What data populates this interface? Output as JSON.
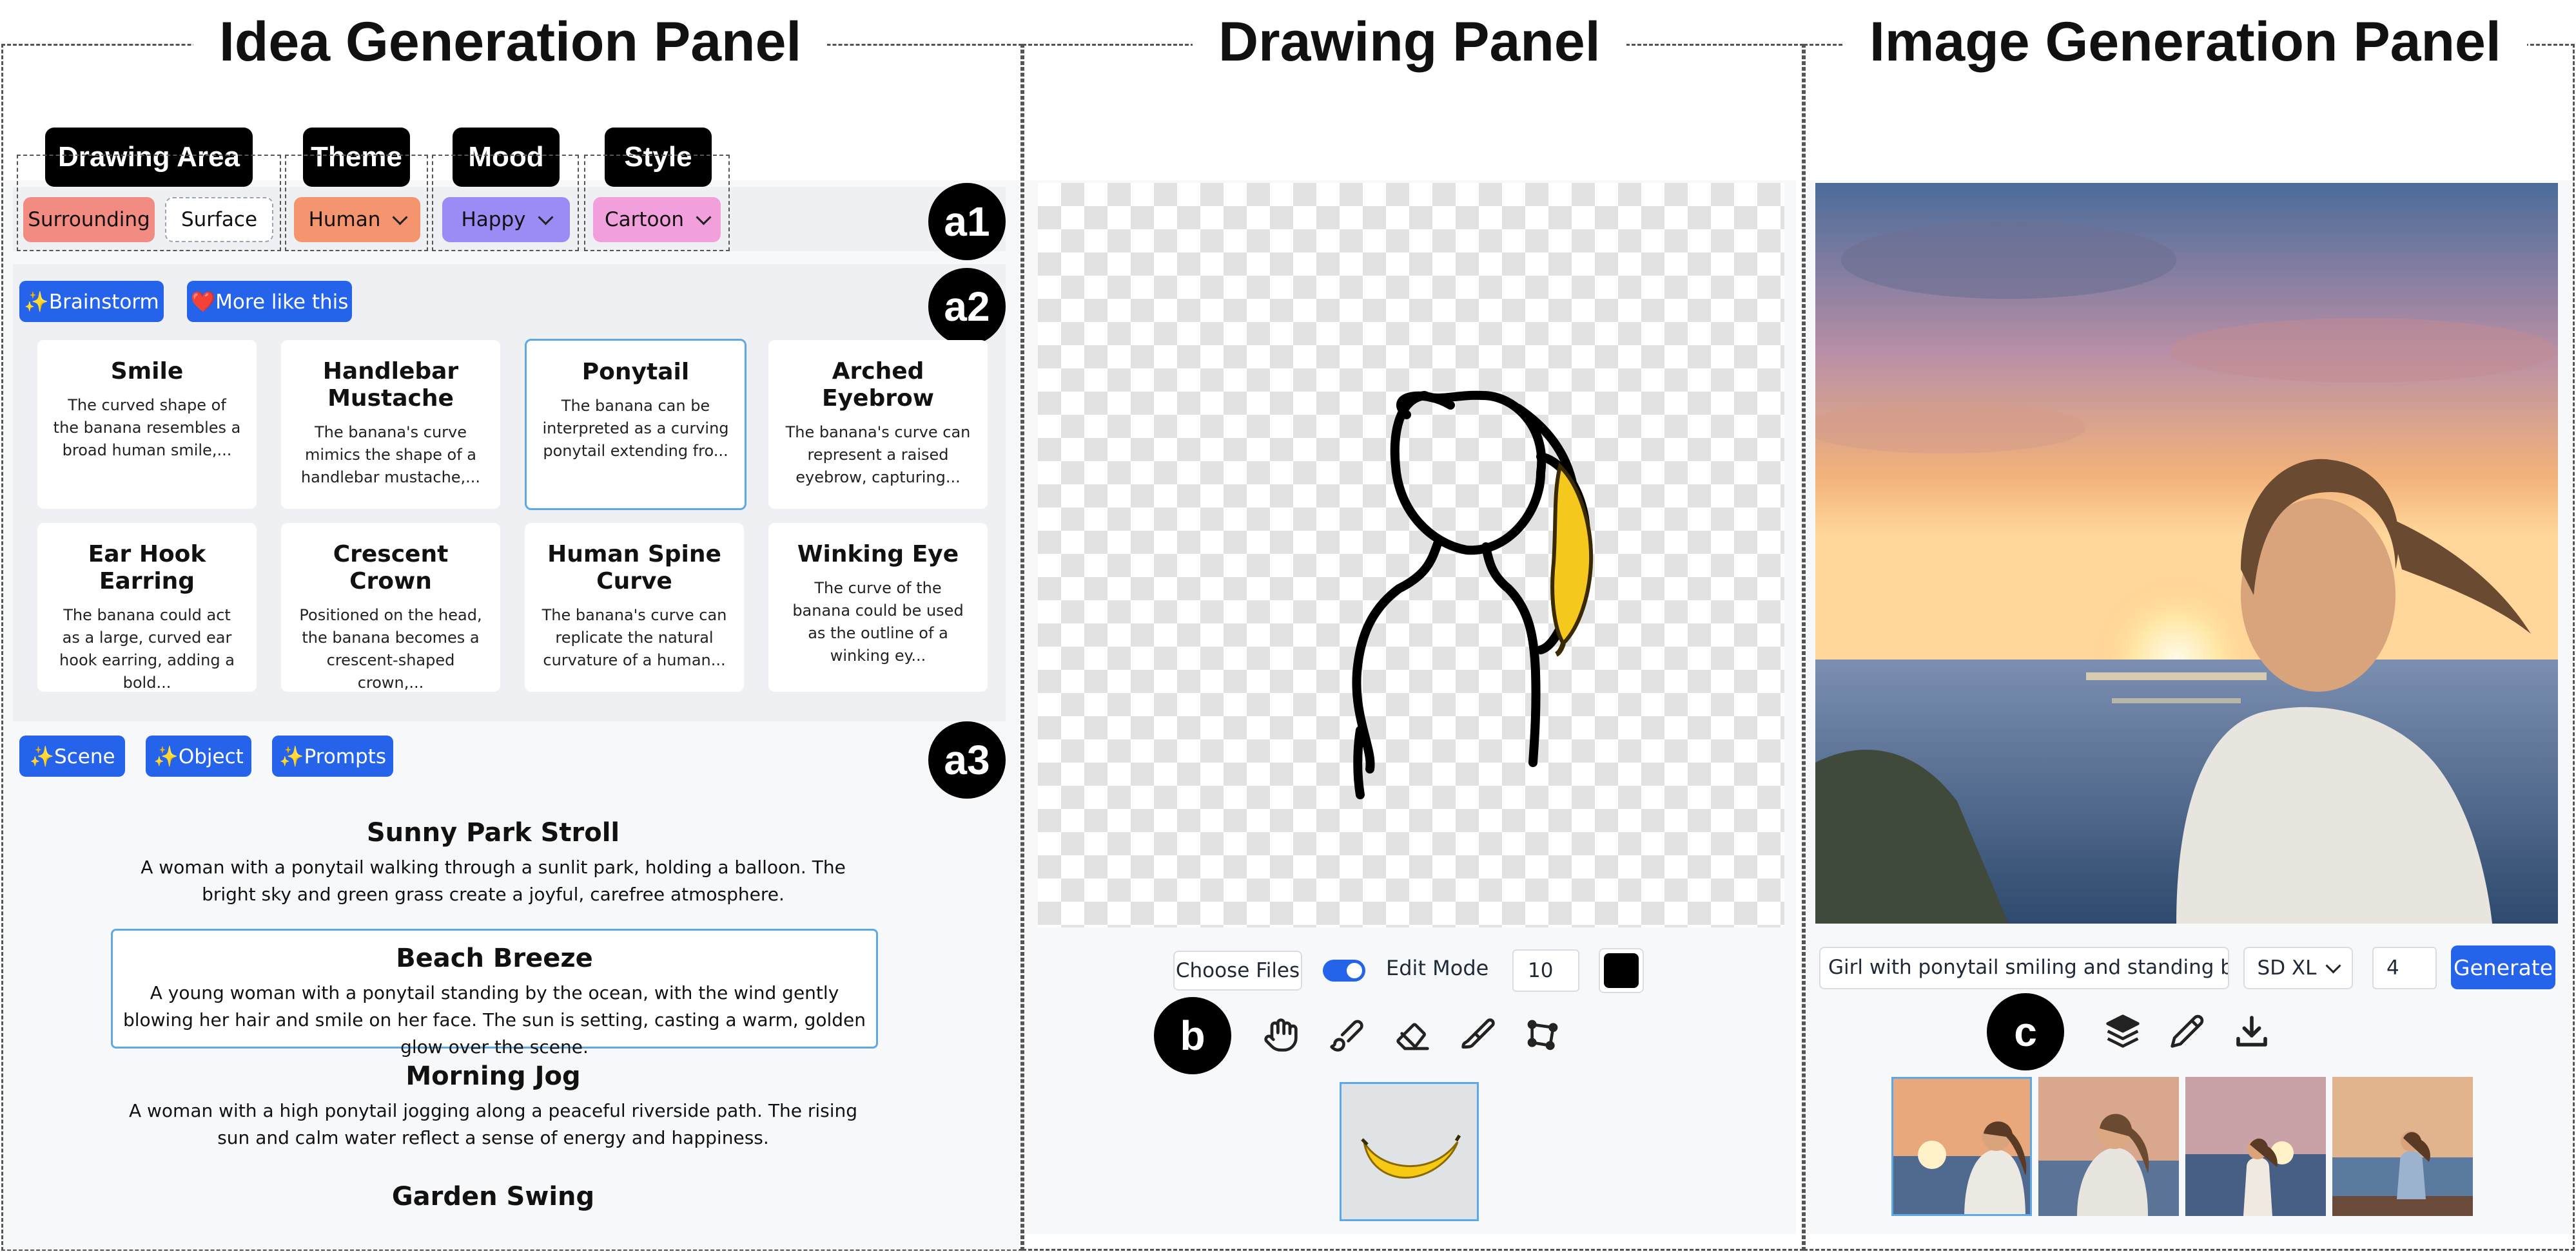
{
  "panels": {
    "idea_title": "Idea Generation Panel",
    "drawing_title": "Drawing Panel",
    "image_title": "Image Generation Panel"
  },
  "badges": {
    "a1": "a1",
    "a2": "a2",
    "a3": "a3",
    "b": "b",
    "c": "c"
  },
  "filters": {
    "drawing_area_label": "Drawing Area",
    "theme_label": "Theme",
    "mood_label": "Mood",
    "style_label": "Style",
    "surrounding": "Surrounding",
    "surface": "Surface",
    "theme_value": "Human",
    "mood_value": "Happy",
    "style_value": "Cartoon"
  },
  "brainstorm": {
    "brainstorm_btn": "✨Brainstorm",
    "more_btn": "❤️More like this",
    "cards": [
      {
        "title": "Smile",
        "desc": "The curved shape of the banana resembles a broad human smile,..."
      },
      {
        "title": "Handlebar Mustache",
        "desc": "The banana's curve mimics the shape of a handlebar mustache,..."
      },
      {
        "title": "Ponytail",
        "desc": "The banana can be interpreted as a curving ponytail extending fro..."
      },
      {
        "title": "Arched Eyebrow",
        "desc": "The banana's curve can represent a raised eyebrow, capturing..."
      },
      {
        "title": "Ear Hook Earring",
        "desc": "The banana could act as a large, curved ear hook earring, adding a bold..."
      },
      {
        "title": "Crescent Crown",
        "desc": "Positioned on the head, the banana becomes a crescent-shaped crown,..."
      },
      {
        "title": "Human Spine Curve",
        "desc": "The banana's curve can replicate the natural curvature of a human..."
      },
      {
        "title": "Winking Eye",
        "desc": "The curve of the banana could be used as the outline of a winking ey..."
      }
    ]
  },
  "scenes": {
    "scene_btn": "✨Scene",
    "object_btn": "✨Object",
    "prompts_btn": "✨Prompts",
    "items": [
      {
        "title": "Sunny Park Stroll",
        "desc": "A woman with a ponytail walking through a sunlit park, holding a balloon. The bright sky and green grass create a joyful, carefree atmosphere."
      },
      {
        "title": "Beach Breeze",
        "desc": "A young woman with a ponytail standing by the ocean, with the wind gently blowing her hair and smile on her face. The sun is setting, casting a warm, golden glow over the scene."
      },
      {
        "title": "Morning Jog",
        "desc": "A woman with a high ponytail jogging along a peaceful riverside path. The rising sun and calm water reflect a sense of energy and happiness."
      },
      {
        "title": "Garden Swing",
        "desc": ""
      }
    ]
  },
  "drawing": {
    "choose_files": "Choose Files",
    "edit_mode": "Edit Mode",
    "brush_size": "10",
    "brush_color": "#000000"
  },
  "imagegen": {
    "prompt": "Girl with ponytail smiling and standing by the beach at sunset",
    "model": "SD XL",
    "count": "4",
    "generate": "Generate"
  },
  "colors": {
    "surrounding": "#f28b82",
    "theme": "#f4956f",
    "mood": "#9b8cf5",
    "style": "#f1a0dc",
    "accent": "#2563eb",
    "selected_border": "#5fa8e6"
  }
}
